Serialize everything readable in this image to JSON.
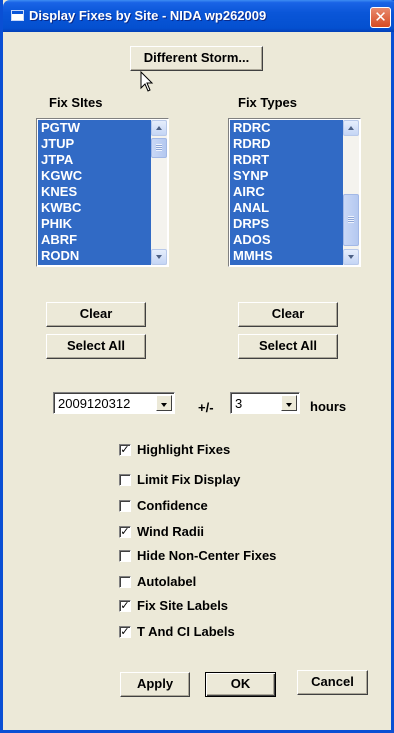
{
  "window": {
    "title": "Display Fixes by Site - NIDA wp262009",
    "close_glyph": "✕",
    "accent": "#0a56d8"
  },
  "toolbar": {
    "different_storm_label": "Different Storm..."
  },
  "fix_sites": {
    "label": "Fix SItes",
    "items": [
      "PGTW",
      "JTUP",
      "JTPA",
      "KGWC",
      "KNES",
      "KWBC",
      "PHIK",
      "ABRF",
      "RODN"
    ],
    "clear_label": "Clear",
    "select_all_label": "Select All"
  },
  "fix_types": {
    "label": "Fix Types",
    "items": [
      "RDRC",
      "RDRD",
      "RDRT",
      "SYNP",
      "AIRC",
      "ANAL",
      "DRPS",
      "ADOS",
      "MMHS"
    ],
    "clear_label": "Clear",
    "select_all_label": "Select All"
  },
  "time": {
    "date_value": "2009120312",
    "plusminus": "+/-",
    "hours_value": "3",
    "hours_label": "hours"
  },
  "options": [
    {
      "label": "Highlight Fixes",
      "checked": true
    },
    {
      "label": "Limit Fix Display",
      "checked": false
    },
    {
      "label": "Confidence",
      "checked": false
    },
    {
      "label": "Wind Radii",
      "checked": true
    },
    {
      "label": "Hide Non-Center Fixes",
      "checked": false
    },
    {
      "label": "Autolabel",
      "checked": false
    },
    {
      "label": "Fix Site Labels",
      "checked": true
    },
    {
      "label": "T And CI Labels",
      "checked": true
    }
  ],
  "footer": {
    "apply_label": "Apply",
    "ok_label": "OK",
    "cancel_label": "Cancel"
  }
}
